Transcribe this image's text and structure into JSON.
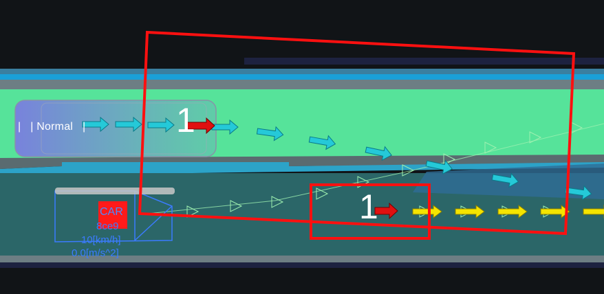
{
  "scene": {
    "ego_label": "|   | Normal   |",
    "trajectory_number_main": "1",
    "trajectory_number_secondary": "1"
  },
  "object": {
    "type": "CAR",
    "id": "8ce9",
    "speed": "10[km/h]",
    "acceleration": "0.0[m/s^2]"
  },
  "colors": {
    "background": "#111417",
    "lane_green": "#56e39a",
    "lane_teal": "#2b6668",
    "arrow_cyan": "#25c9d8",
    "arrow_yellow": "#f5e400",
    "arrow_red": "#e01010",
    "box_red": "#ff1010",
    "object_blue": "#3b7bff"
  }
}
